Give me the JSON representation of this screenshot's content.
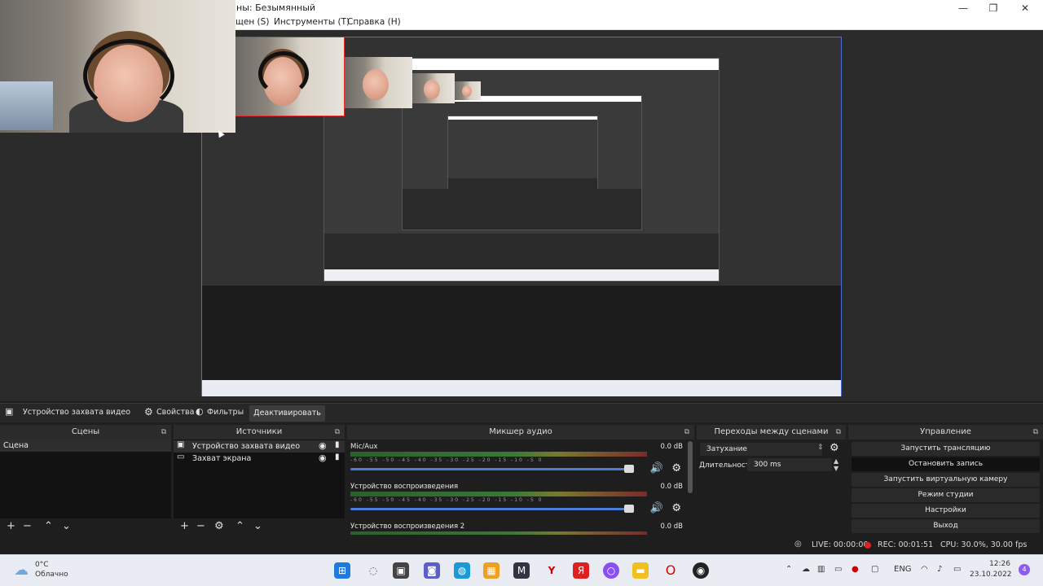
{
  "window": {
    "title": "ны: Безымянный",
    "minimize": "—",
    "restore": "❐",
    "close": "✕"
  },
  "menu": [
    {
      "label": "щен (S)"
    },
    {
      "label": "Инструменты (T)"
    },
    {
      "label": "Справка (H)"
    }
  ],
  "source_toolbar": {
    "source_name": "Устройство захвата видео",
    "properties": "Свойства",
    "filters": "Фильтры",
    "deactivate": "Деактивировать"
  },
  "scenes": {
    "header": "Сцены",
    "items": [
      "Сцена"
    ]
  },
  "sources": {
    "header": "Источники",
    "items": [
      "Устройство захвата видео",
      "Захват экрана"
    ]
  },
  "mixer": {
    "header": "Микшер аудио",
    "ticks": "-60 -55 -50 -45 -40 -35 -30 -25 -20 -15 -10 -5 0",
    "channels": [
      {
        "name": "Mic/Aux",
        "db": "0.0 dB",
        "volume": 100
      },
      {
        "name": "Устройство воспроизведения",
        "db": "0.0 dB",
        "volume": 100
      },
      {
        "name": "Устройство воспроизведения 2",
        "db": "0.0 dB",
        "volume": 100
      }
    ]
  },
  "transitions": {
    "header": "Переходы между сценами",
    "selected": "Затухание",
    "duration_label": "Длительность",
    "duration_value": "300 ms"
  },
  "controls": {
    "header": "Управление",
    "buttons": [
      "Запустить трансляцию",
      "Остановить запись",
      "Запустить виртуальную камеру",
      "Режим студии",
      "Настройки",
      "Выход"
    ]
  },
  "status": {
    "live": "LIVE: 00:00:00",
    "rec": "REC: 00:01:51",
    "cpu": "CPU: 30.0%, 30.00 fps"
  },
  "taskbar": {
    "temp": "0°C",
    "weather": "Облачно",
    "lang": "ENG",
    "time": "12:26",
    "date": "23.10.2022",
    "notifications": "4"
  },
  "colors": {
    "accent": "#4a6fd8",
    "record": "#e02020",
    "dark_bg": "#1e1e1e"
  }
}
